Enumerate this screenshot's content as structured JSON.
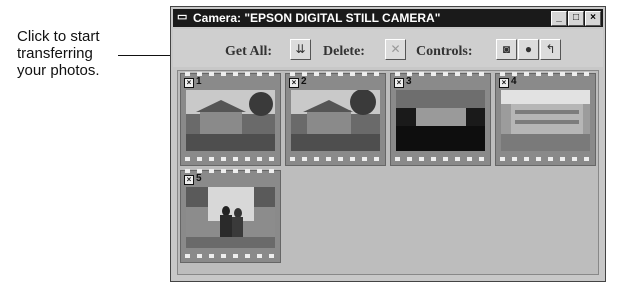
{
  "callout": {
    "line1": "Click to start",
    "line2": "transferring",
    "line3": "your photos."
  },
  "window": {
    "title": "Camera: \"EPSON DIGITAL STILL CAMERA\"",
    "controls": [
      "_",
      "□",
      "×"
    ]
  },
  "toolbar": {
    "get_all_label": "Get All:",
    "delete_label": "Delete:",
    "controls_label": "Controls:"
  },
  "photos": [
    {
      "number": "1",
      "icon": "house-photo"
    },
    {
      "number": "2",
      "icon": "house-photo"
    },
    {
      "number": "3",
      "icon": "house-photo-dark"
    },
    {
      "number": "4",
      "icon": "building-photo"
    },
    {
      "number": "5",
      "icon": "people-photo"
    }
  ]
}
